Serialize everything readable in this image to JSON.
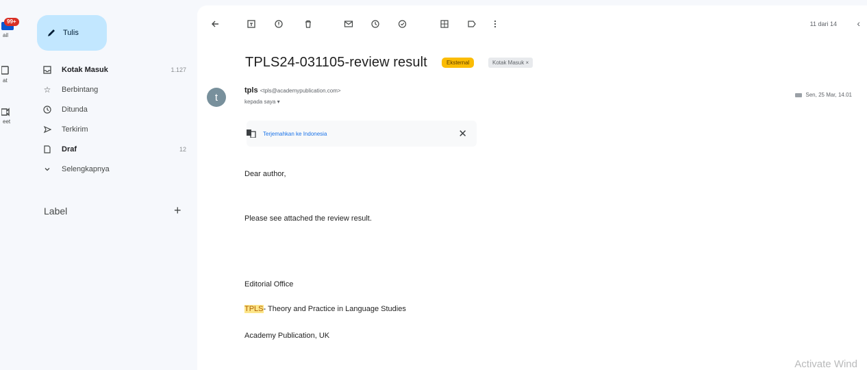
{
  "rail": {
    "badge": "99+",
    "items": [
      {
        "label": "ail",
        "icon": "mail-icon"
      },
      {
        "label": "at",
        "icon": "chat-icon"
      },
      {
        "label": "eet",
        "icon": "meet-icon"
      }
    ]
  },
  "nav": {
    "compose_label": "Tulis",
    "items": [
      {
        "label": "Kotak Masuk",
        "count": "1.127",
        "icon": "inbox-icon"
      },
      {
        "label": "Berbintang",
        "count": "",
        "icon": "star-icon"
      },
      {
        "label": "Ditunda",
        "count": "",
        "icon": "clock-icon"
      },
      {
        "label": "Terkirim",
        "count": "",
        "icon": "send-icon"
      },
      {
        "label": "Draf",
        "count": "12",
        "icon": "draft-icon"
      },
      {
        "label": "Selengkapnya",
        "count": "",
        "icon": "chevron-down-icon"
      }
    ],
    "label_heading": "Label",
    "label_add": "+"
  },
  "toolbar": {
    "pager": "11 dari 14",
    "prev": "‹"
  },
  "message": {
    "subject": "TPLS24-031105-review result",
    "chip_external": "Eksternal",
    "chip_inbox": "Kotak Masuk ×",
    "avatar_letter": "t",
    "sender_name": "tpls",
    "sender_email": "<tpls@academypublication.com>",
    "to_me": "kepada saya ▾",
    "date": "Sen, 25 Mar, 14.01",
    "translate_link": "Terjemahkan ke Indonesia",
    "translate_close": "✕",
    "body": {
      "greeting": "Dear author,",
      "line1": "Please see attached the review result.",
      "sig1": "Editorial Office",
      "sig2_hl": "TPLS",
      "sig2_rest": "- Theory and Practice in Language Studies",
      "sig3": "Academy Publication, UK"
    }
  },
  "watermark": "Activate Wind",
  "colors": {
    "compose_bg": "#c2e7ff",
    "external_chip": "#fbbc04",
    "badge": "#d93025",
    "link": "#1a73e8",
    "highlight": "#fce589"
  }
}
